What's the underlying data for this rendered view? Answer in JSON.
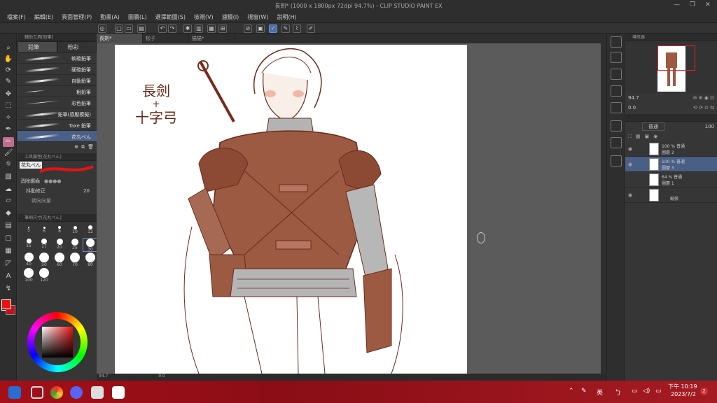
{
  "window": {
    "title": "長劍* (1000 x 1800px 72dpi 94.7%)  - CLIP STUDIO PAINT EX",
    "minimize": "—",
    "maximize": "❐",
    "close": "✕"
  },
  "menu": [
    "檔案(F)",
    "編輯(E)",
    "頁面管理(P)",
    "動畫(A)",
    "圖層(L)",
    "選擇範圍(S)",
    "檢視(V)",
    "濾鏡(I)",
    "視窗(W)",
    "說明(H)"
  ],
  "subtool": {
    "panel_title": "輔助工具[鉛筆]",
    "tabs": [
      "鉛筆",
      "粉彩"
    ],
    "brushes": [
      "軟碳鉛筆",
      "硬碳鉛筆",
      "自動鉛筆",
      "粗鉛筆",
      "彩色鉛筆",
      "鉛筆(感壓模擬)",
      "Taxe 鉛筆",
      "花丸ぺん"
    ],
    "props_title": "工具屬性[花丸ぺん]",
    "props_name": "花丸ぺん",
    "erase_label": "消除鋸齒",
    "stabilize_label": "抖動修正",
    "stabilize_value": "20",
    "vector_label": "朝向向量"
  },
  "brush_size": {
    "panel_title": "筆刷尺寸[花丸ぺん]",
    "sizes": [
      "5",
      "6",
      "8",
      "10",
      "12",
      "15",
      "17",
      "20",
      "25",
      "30",
      "40",
      "50",
      "60",
      "70",
      "80",
      "100",
      "120"
    ],
    "selected": "30"
  },
  "colors": {
    "main": "#e8120f",
    "sub": "#c4121a"
  },
  "document": {
    "tabs": [
      "長劍*",
      "松子",
      "猫猫*"
    ],
    "annotation_line1": "長劍",
    "annotation_line2": "+",
    "annotation_line3": "十字弓",
    "zoom": "94.7",
    "rotation": "0.0"
  },
  "navigator": {
    "title": "導航器",
    "zoom": "94.7",
    "angle": "0.0"
  },
  "layers": {
    "blend": "普通",
    "opacity": "100",
    "items": [
      {
        "line1": "100 % 普通",
        "line2": "圖層 2",
        "selected": false
      },
      {
        "line1": "100 % 普通",
        "line2": "圖層 3",
        "selected": true
      },
      {
        "line1": "64 % 普通",
        "line2": "圖層 1",
        "selected": false
      },
      {
        "line1": "",
        "line2": "紙張",
        "selected": false
      }
    ]
  },
  "taskbar": {
    "ime1": "英",
    "time": "下午 10:19",
    "date": "2023/7/2",
    "badge": "2"
  }
}
